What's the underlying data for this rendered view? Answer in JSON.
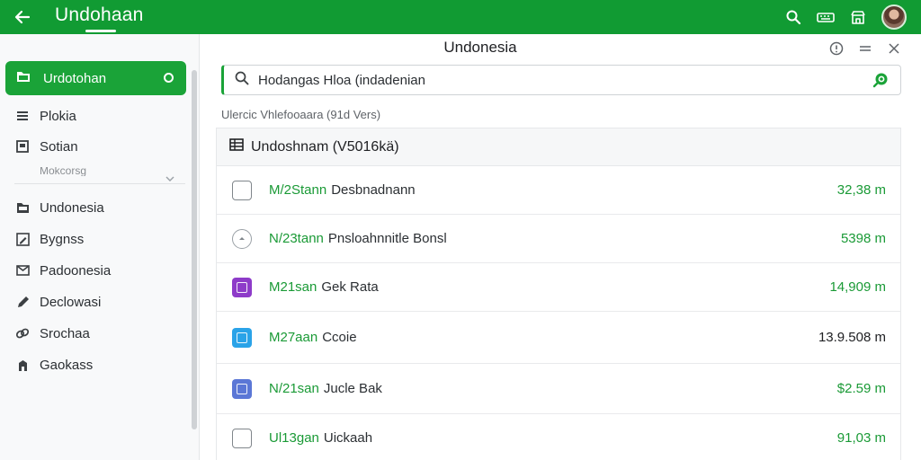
{
  "appbar": {
    "title": "Undohaan",
    "color": "#119b33",
    "actions": [
      "search-icon",
      "keyboard-icon",
      "store-icon",
      "avatar"
    ]
  },
  "sidebar": {
    "active": {
      "label": "Urdotohan",
      "icon": "folder-icon"
    },
    "items": [
      {
        "label": "Plokia",
        "icon": "list-icon"
      },
      {
        "label": "Sotian",
        "icon": "inbox-icon"
      },
      {
        "label": "Undonesia",
        "icon": "folder-icon"
      },
      {
        "label": "Bygnss",
        "icon": "edit-box-icon"
      },
      {
        "label": "Padoonesia",
        "icon": "mail-icon"
      },
      {
        "label": "Declowasi",
        "icon": "pencil-icon"
      },
      {
        "label": "Srochaa",
        "icon": "link-icon"
      },
      {
        "label": "Gaokass",
        "icon": "building-icon"
      }
    ],
    "partial_label": "Mokcorsg"
  },
  "main": {
    "title": "Undonesia",
    "window_actions": [
      "help-icon",
      "menu-icon",
      "close-icon"
    ],
    "search": {
      "value": "Hodangas Hloa (indadenian",
      "placeholder": "Search"
    },
    "caption": "Ulercic Vhlefooaara (91d Vers)",
    "list_header": "Undoshnam (V5016kä)",
    "rows": [
      {
        "code": "M/2Stann",
        "name": "Desbnadnann",
        "value": "32,38 m",
        "value_color": "green",
        "icon": "checkbox-icon"
      },
      {
        "code": "N/23tann",
        "name": "Pnsloahnnitle Bonsl",
        "value": "5398 m",
        "value_color": "green",
        "icon": "circle-icon"
      },
      {
        "code": "M21san",
        "name": "Gek Rata",
        "value": "14,909 m",
        "value_color": "green",
        "icon": "purple-app-icon"
      },
      {
        "code": "M27aan",
        "name": "Ccoie",
        "value": "13.9.508 m",
        "value_color": "dark",
        "icon": "blue-app-icon"
      },
      {
        "code": "N/21san",
        "name": "Jucle Bak",
        "value": "$2.59 m",
        "value_color": "green",
        "icon": "indigo-app-icon"
      },
      {
        "code": "Ul13gan",
        "name": "Uickaah",
        "value": "91,03 m",
        "value_color": "green",
        "icon": "checkbox-icon"
      }
    ]
  },
  "colors": {
    "accent": "#1aa338",
    "purple": "#8e3bc9",
    "blue": "#2aa3e8",
    "indigo": "#5b77d6"
  }
}
